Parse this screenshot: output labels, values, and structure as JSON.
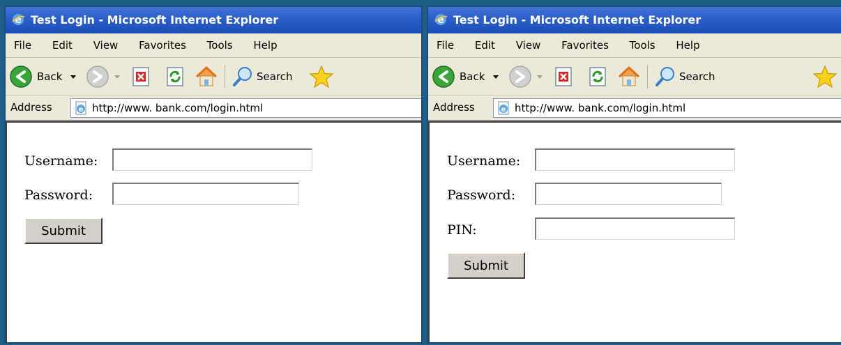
{
  "colors": {
    "desktop": "#1e5f86",
    "titlebar": "#2c5ec9",
    "chrome": "#ece9d8"
  },
  "windows": [
    {
      "title": "Test Login - Microsoft Internet Explorer",
      "menu": [
        "File",
        "Edit",
        "View",
        "Favorites",
        "Tools",
        "Help"
      ],
      "toolbar": {
        "back_label": "Back",
        "search_label": "Search"
      },
      "address": {
        "label": "Address",
        "url": "http://www.  bank.com/login.html"
      },
      "form": {
        "username_label": "Username:",
        "username_value": "",
        "password_label": "Password:",
        "password_value": "",
        "submit_label": "Submit"
      }
    },
    {
      "title": "Test Login - Microsoft Internet Explorer",
      "menu": [
        "File",
        "Edit",
        "View",
        "Favorites",
        "Tools",
        "Help"
      ],
      "toolbar": {
        "back_label": "Back",
        "search_label": "Search"
      },
      "address": {
        "label": "Address",
        "url": "http://www.  bank.com/login.html"
      },
      "form": {
        "username_label": "Username:",
        "username_value": "",
        "password_label": "Password:",
        "password_value": "",
        "pin_label": "PIN:",
        "pin_value": "",
        "submit_label": "Submit"
      }
    }
  ],
  "icons": [
    "ie-logo-icon",
    "back-arrow-icon",
    "forward-arrow-icon",
    "dropdown-arrow-icon",
    "stop-icon",
    "refresh-icon",
    "home-icon",
    "search-icon",
    "favorites-star-icon",
    "page-icon"
  ]
}
